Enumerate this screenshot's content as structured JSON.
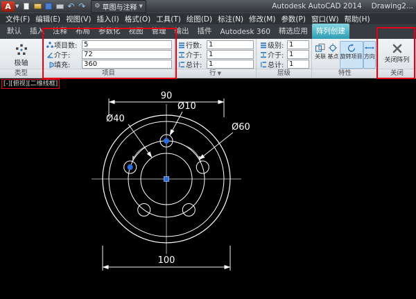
{
  "titlebar": {
    "logo_letter": "A",
    "workspace_label": "草图与注释",
    "app_title": "Autodesk AutoCAD 2014",
    "doc_title": "Drawing2..."
  },
  "menubar": {
    "items": [
      "文件(F)",
      "编辑(E)",
      "视图(V)",
      "插入(I)",
      "格式(O)",
      "工具(T)",
      "绘图(D)",
      "标注(N)",
      "修改(M)",
      "参数(P)",
      "窗口(W)",
      "帮助(H)"
    ]
  },
  "ribbon_tabs": [
    "默认",
    "插入",
    "注释",
    "布局",
    "参数化",
    "视图",
    "管理",
    "输出",
    "插件",
    "Autodesk 360",
    "精选应用",
    "阵列创建"
  ],
  "ribbon": {
    "type_panel": {
      "title": "类型",
      "polar_button_label": "极轴"
    },
    "items_panel": {
      "title": "项目",
      "fields": [
        {
          "label": "项目数:",
          "value": "5"
        },
        {
          "label": "介于:",
          "value": "72"
        },
        {
          "label": "填充:",
          "value": "360"
        }
      ]
    },
    "rows_panel": {
      "title": "行",
      "fields": [
        {
          "label": "行数:",
          "value": "1"
        },
        {
          "label": "介于:",
          "value": "1"
        },
        {
          "label": "总计:",
          "value": "1"
        }
      ]
    },
    "levels_panel": {
      "title": "层级",
      "fields": [
        {
          "label": "级别:",
          "value": "1"
        },
        {
          "label": "介于:",
          "value": "1"
        },
        {
          "label": "总计:",
          "value": "1"
        }
      ]
    },
    "properties_panel": {
      "title": "特性",
      "buttons": [
        "关联",
        "基点",
        "旋转项目",
        "方向"
      ]
    },
    "close_panel": {
      "title": "关闭",
      "button_label": "关闭阵列"
    }
  },
  "canvas": {
    "viewport_controls": "[-][俯视][二维线框]",
    "drawing": {
      "dim_top": "90",
      "dim_bottom": "100",
      "label_d40": "Ø40",
      "label_d10": "Ø10",
      "label_d60": "Ø60"
    }
  },
  "colors": {
    "annotation_red": "#e60012",
    "contextual_tab_teal": "#3fb0c4",
    "grip_blue": "#2a6ee0"
  }
}
